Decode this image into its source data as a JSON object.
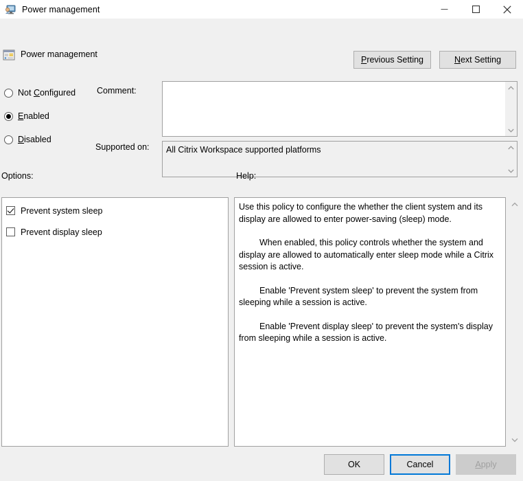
{
  "window": {
    "title": "Power management",
    "icon": "policy-monitor-icon",
    "controls": [
      {
        "name": "minimize",
        "glyph": "minimize-icon"
      },
      {
        "name": "maximize",
        "glyph": "maximize-icon"
      },
      {
        "name": "close",
        "glyph": "close-icon"
      }
    ]
  },
  "header": {
    "icon": "policy-setting-icon",
    "title": "Power management",
    "previous_label_pre": "",
    "previous_accel": "P",
    "previous_label_post": "revious Setting",
    "next_accel": "N",
    "next_label_post": "ext Setting"
  },
  "state": {
    "options": [
      {
        "label_pre": "Not ",
        "accel": "C",
        "label_post": "onfigured",
        "selected": false
      },
      {
        "label_pre": "",
        "accel": "E",
        "label_post": "nabled",
        "selected": true
      },
      {
        "label_pre": "",
        "accel": "D",
        "label_post": "isabled",
        "selected": false
      }
    ]
  },
  "comment": {
    "label": "Comment:",
    "value": "",
    "placeholder": ""
  },
  "supported": {
    "label": "Supported on:",
    "value": "All Citrix Workspace supported platforms"
  },
  "sections": {
    "options_label": "Options:",
    "help_label": "Help:"
  },
  "options_panel": {
    "checkboxes": [
      {
        "label": "Prevent system sleep",
        "checked": true
      },
      {
        "label": "Prevent display sleep",
        "checked": false
      }
    ]
  },
  "help_panel": {
    "paragraphs": [
      "Use this policy to configure the whether the client system and its display are allowed to enter power-saving (sleep) mode.",
      "When enabled, this policy controls whether the system and display are allowed to automatically enter sleep mode while a Citrix session is active.",
      "Enable 'Prevent system sleep' to prevent the system from sleeping while a session is active.",
      "Enable 'Prevent display sleep' to prevent the system's display from sleeping while a session is active."
    ]
  },
  "footer": {
    "ok_label": "OK",
    "cancel_label": "Cancel",
    "apply_accel": "A",
    "apply_label_post": "pply"
  },
  "colors": {
    "accent": "#0078d7",
    "window_bg": "#f0f0f0",
    "field_bg": "#ffffff",
    "border": "#a0a0a0",
    "button_bg": "#e1e1e1",
    "disabled_text": "#a0a0a0"
  }
}
